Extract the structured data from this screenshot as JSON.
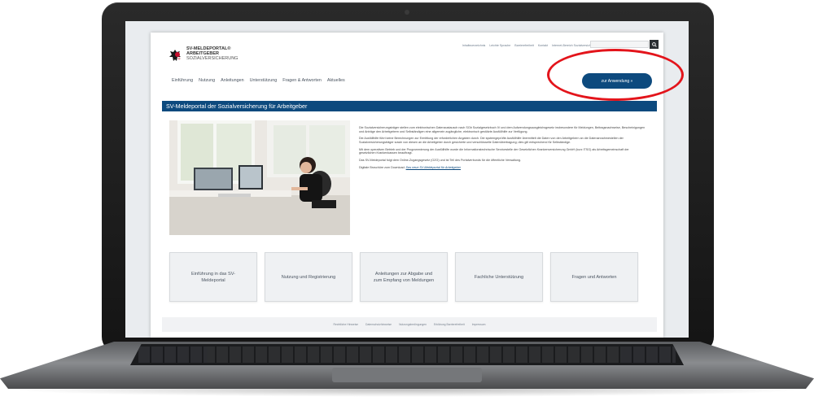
{
  "logo": {
    "line1": "SV-MELDEPORTAL®",
    "line2": "ARBEITGEBER",
    "line3": "SOZIALVERSICHERUNG"
  },
  "topmeta": [
    "Inhaltsverzeichnis",
    "Leichte Sprache",
    "Barrierefreiheit",
    "Kontakt",
    "Internet-Bereich Sozialversicherung"
  ],
  "nav": [
    "Einführung",
    "Nutzung",
    "Anleitungen",
    "Unterstützung",
    "Fragen & Antworten",
    "Aktuelles"
  ],
  "cta_label": "zur Anwendung »",
  "banner_title": "SV-Meldeportal der Sozialversicherung für Arbeitgeber",
  "intro": {
    "p1": "Die Sozialversicherungsträger stellen zum elektronischen Datenaustausch nach SGb Sozialgesetzbuch IV und dem Aufwendungsausgleichsgesetz insbesondere für Meldungen, Beitragsnachweise, Bescheinigungen und Anträge den Arbeitgebern und Selbständigen eine allgemein zugängliche, elektronisch gestützte Ausfüllhilfe zur Verfügung.",
    "p2": "Die Ausfüllhilfe führt keine Berechnungen zur Ermittlung der erforderlichen Angaben durch. Die systemgeprüfte Ausfüllhilfe übermittelt die Daten von den Arbeitgebern an die Datenannahmestellen der Sozialversicherungsträger sowie von diesen an die Arbeitgeber durch gesicherte und verschlüsselte Datenübertragung; dies gilt entsprechend für Selbständige.",
    "p3": "Mit dem operativen Betrieb und der Programmierung der Ausfüllhilfe wurde die Informationstechnische Servicestelle der Gesetzlichen Krankenversicherung GmbH (kurz ITSG) als Arbeitsgemeinschaft der gesetzlichen Krankenkassen beauftragt.",
    "p4": "Das SV-Meldeportal folgt dem Online-Zugangsgesetz (OZG) und ist Teil des Portalverbunds für die öffentliche Verwaltung.",
    "p5_prefix": "Digitale Broschüre zum Download:",
    "p5_link": "Das neue SV-Meldeportal für Arbeitgeber"
  },
  "tiles": [
    "Einführung in das SV-Meldeportal",
    "Nutzung und Registrierung",
    "Anleitungen zur Abgabe und zum Empfang von Meldungen",
    "Fachliche Unterstützung",
    "Fragen und Antworten"
  ],
  "footer": [
    "Rechtliche Hinweise",
    "Datenschutzhinweise",
    "Nutzungsbedingungen",
    "Erklärung Barrierefreiheit",
    "Impressum"
  ],
  "colors": {
    "brand_blue": "#0d4a7e",
    "highlight_red": "#e3141b"
  }
}
